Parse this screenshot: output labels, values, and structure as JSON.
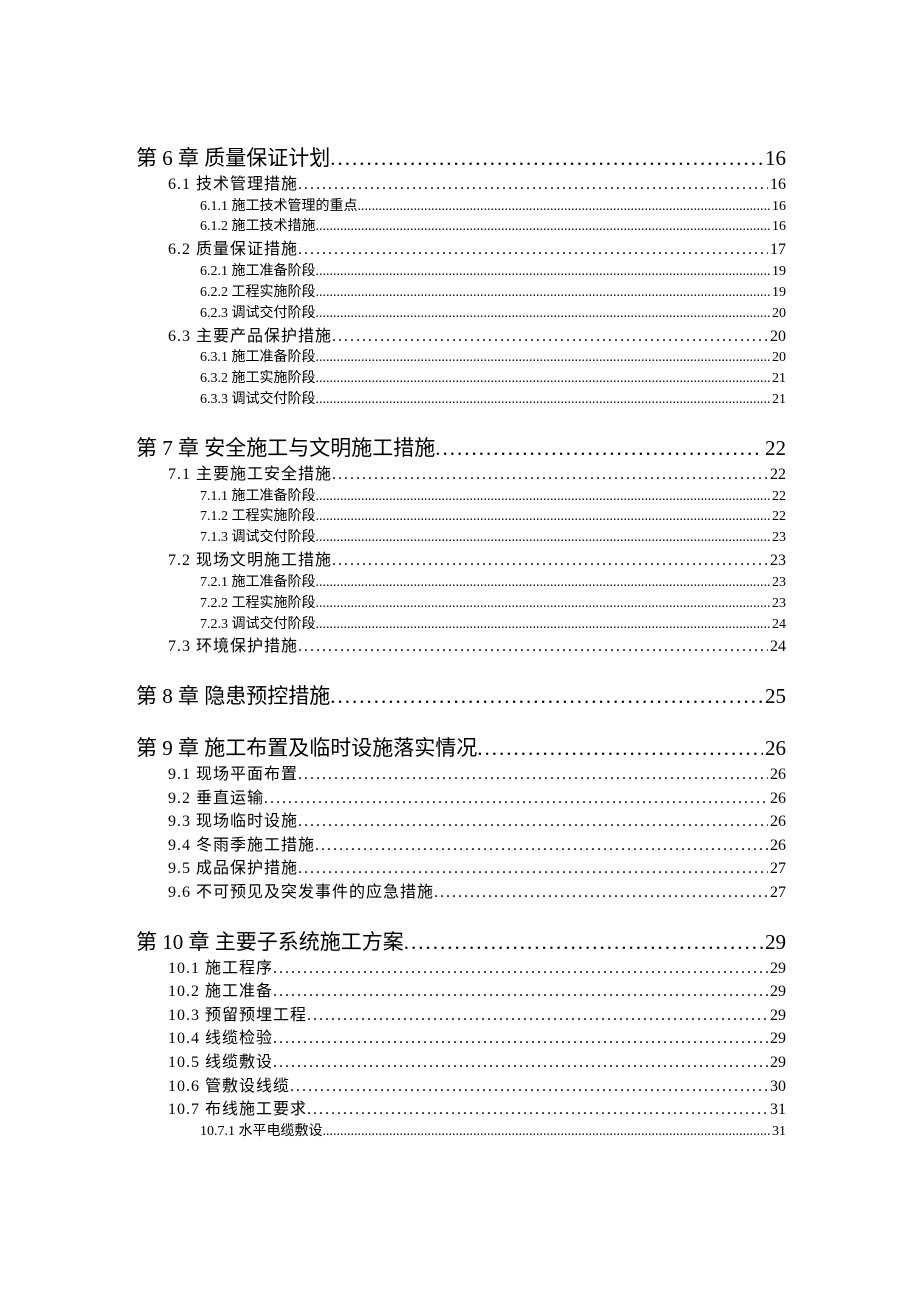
{
  "toc": [
    {
      "level": 1,
      "title": "第 6 章  质量保证计划",
      "page": "16"
    },
    {
      "level": 2,
      "title": "6.1 技术管理措施",
      "page": "16"
    },
    {
      "level": 3,
      "title": "6.1.1 施工技术管理的重点",
      "page": "16"
    },
    {
      "level": 3,
      "title": "6.1.2 施工技术措施",
      "page": "16"
    },
    {
      "level": 2,
      "title": "6.2 质量保证措施",
      "page": "17"
    },
    {
      "level": 3,
      "title": "6.2.1 施工准备阶段",
      "page": "19"
    },
    {
      "level": 3,
      "title": "6.2.2 工程实施阶段",
      "page": "19"
    },
    {
      "level": 3,
      "title": "6.2.3 调试交付阶段",
      "page": "20"
    },
    {
      "level": 2,
      "title": "6.3 主要产品保护措施",
      "page": "20"
    },
    {
      "level": 3,
      "title": "6.3.1 施工准备阶段",
      "page": "20"
    },
    {
      "level": 3,
      "title": "6.3.2 施工实施阶段",
      "page": "21"
    },
    {
      "level": 3,
      "title": "6.3.3 调试交付阶段",
      "page": "21"
    },
    {
      "level": 1,
      "title": "第 7 章  安全施工与文明施工措施",
      "page": "22"
    },
    {
      "level": 2,
      "title": "7.1 主要施工安全措施",
      "page": "22"
    },
    {
      "level": 3,
      "title": "7.1.1 施工准备阶段",
      "page": "22"
    },
    {
      "level": 3,
      "title": "7.1.2 工程实施阶段",
      "page": "22"
    },
    {
      "level": 3,
      "title": "7.1.3 调试交付阶段",
      "page": "23"
    },
    {
      "level": 2,
      "title": "7.2 现场文明施工措施",
      "page": "23"
    },
    {
      "level": 3,
      "title": "7.2.1 施工准备阶段",
      "page": "23"
    },
    {
      "level": 3,
      "title": "7.2.2 工程实施阶段",
      "page": "23"
    },
    {
      "level": 3,
      "title": "7.2.3 调试交付阶段",
      "page": "24"
    },
    {
      "level": 2,
      "title": "7.3 环境保护措施",
      "page": "24"
    },
    {
      "level": 1,
      "title": "第 8 章  隐患预控措施",
      "page": "25"
    },
    {
      "level": 1,
      "title": "第 9 章  施工布置及临时设施落实情况",
      "page": "26"
    },
    {
      "level": 2,
      "title": "9.1 现场平面布置",
      "page": "26"
    },
    {
      "level": 2,
      "title": "9.2 垂直运输",
      "page": "26"
    },
    {
      "level": 2,
      "title": "9.3 现场临时设施",
      "page": "26"
    },
    {
      "level": 2,
      "title": "9.4 冬雨季施工措施",
      "page": "26"
    },
    {
      "level": 2,
      "title": "9.5 成品保护措施",
      "page": "27"
    },
    {
      "level": 2,
      "title": "9.6 不可预见及突发事件的应急措施",
      "page": "27"
    },
    {
      "level": 1,
      "title": "第 10 章  主要子系统施工方案",
      "page": "29"
    },
    {
      "level": 2,
      "title": "10.1 施工程序",
      "page": "29"
    },
    {
      "level": 2,
      "title": "10.2 施工准备",
      "page": "29"
    },
    {
      "level": 2,
      "title": "10.3 预留预埋工程",
      "page": "29"
    },
    {
      "level": 2,
      "title": "10.4 线缆检验",
      "page": "29"
    },
    {
      "level": 2,
      "title": "10.5 线缆敷设",
      "page": "29"
    },
    {
      "level": 2,
      "title": "10.6 管敷设线缆",
      "page": "30"
    },
    {
      "level": 2,
      "title": "10.7 布线施工要求",
      "page": "31"
    },
    {
      "level": 3,
      "title": "10.7.1 水平电缆敷设",
      "page": "31"
    }
  ],
  "leaders": {
    "dotWide": "........................................................................................................................",
    "dotTight": "............................................................................................................................................................................................................"
  }
}
